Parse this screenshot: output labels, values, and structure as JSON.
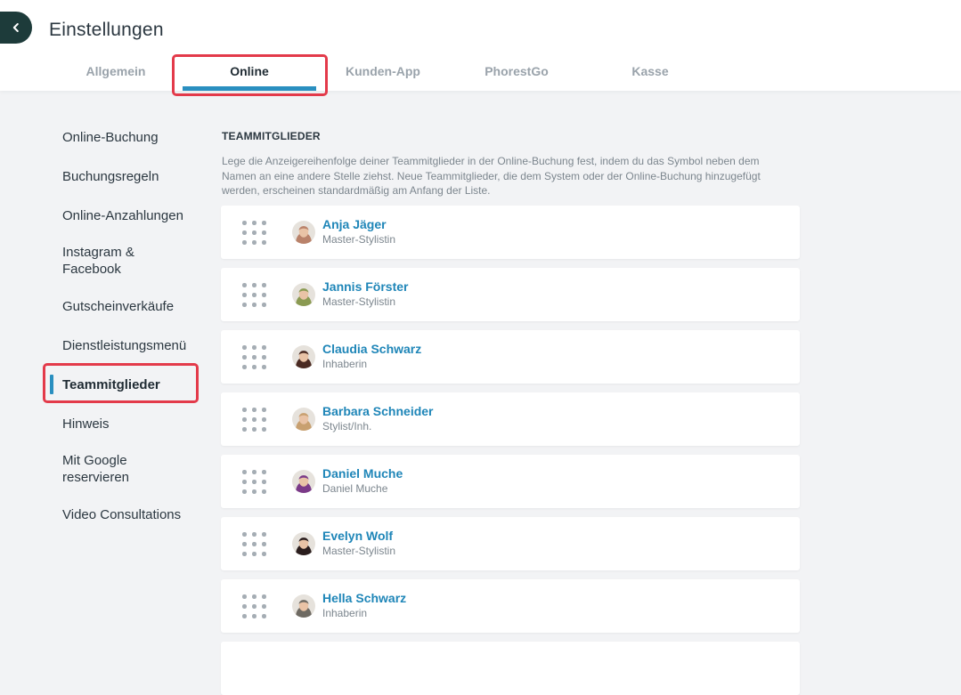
{
  "header": {
    "title": "Einstellungen",
    "tabs": [
      {
        "label": "Allgemein"
      },
      {
        "label": "Online"
      },
      {
        "label": "Kunden-App"
      },
      {
        "label": "PhorestGo"
      },
      {
        "label": "Kasse"
      }
    ],
    "active_tab": "Online"
  },
  "sidebar": {
    "items": [
      {
        "label": "Online-Buchung"
      },
      {
        "label": "Buchungsregeln"
      },
      {
        "label": "Online-Anzahlungen"
      },
      {
        "label": "Instagram & Facebook"
      },
      {
        "label": "Gutscheinverkäufe"
      },
      {
        "label": "Dienstleistungsmenü"
      },
      {
        "label": "Teammitglieder"
      },
      {
        "label": "Hinweis"
      },
      {
        "label": "Mit Google reservieren"
      },
      {
        "label": "Video Consultations"
      }
    ],
    "active_item": "Teammitglieder"
  },
  "main": {
    "heading": "TEAMMITGLIEDER",
    "description": "Lege die Anzeigereihenfolge deiner Teammitglieder in der Online-Buchung fest, indem du das Symbol neben dem Namen an eine andere Stelle ziehst. Neue Teammitglieder, die dem System oder der Online-Buchung hinzugefügt werden, erscheinen standardmäßig am Anfang der Liste.",
    "members": [
      {
        "name": "Anja Jäger",
        "role": "Master-Stylistin",
        "avatar_color": "#b9826a"
      },
      {
        "name": "Jannis Förster",
        "role": "Master-Stylistin",
        "avatar_color": "#8a9a52"
      },
      {
        "name": "Claudia Schwarz",
        "role": "Inhaberin",
        "avatar_color": "#4a2a22"
      },
      {
        "name": "Barbara Schneider",
        "role": "Stylist/Inh.",
        "avatar_color": "#c8a070"
      },
      {
        "name": "Daniel Muche",
        "role": "Daniel Muche",
        "avatar_color": "#7b3a88"
      },
      {
        "name": "Evelyn Wolf",
        "role": "Master-Stylistin",
        "avatar_color": "#2a1d1d"
      },
      {
        "name": "Hella Schwarz",
        "role": "Inhaberin",
        "avatar_color": "#6e6a62"
      }
    ]
  },
  "colors": {
    "accent": "#2a8fc0",
    "name_link": "#1f86b8",
    "highlight": "#e33a4a",
    "back_button": "#1d3b3a"
  }
}
